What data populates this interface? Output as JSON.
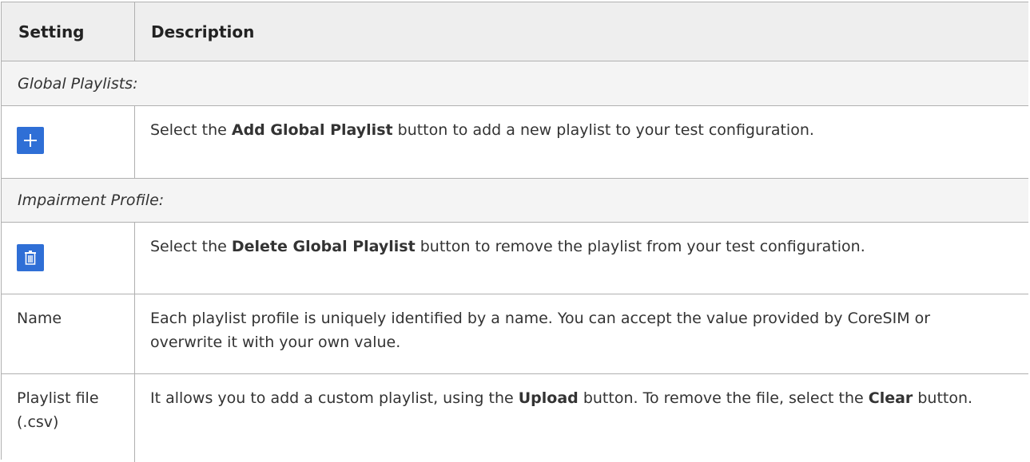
{
  "header": {
    "setting": "Setting",
    "description": "Description"
  },
  "sections": {
    "global_playlists": "Global Playlists:",
    "impairment_profile": "Impairment Profile:"
  },
  "rows": {
    "add": {
      "icon": "plus-icon",
      "pre": "Select the ",
      "bold": "Add Global Playlist",
      "post": " button to add a new playlist to your test configuration."
    },
    "delete": {
      "icon": "trash-icon",
      "pre": "Select the ",
      "bold": "Delete Global Playlist",
      "post": " button to remove the playlist from your test configuration."
    },
    "name": {
      "setting": "Name",
      "description": "Each playlist profile is uniquely identified by a name. You can accept the value provided by CoreSIM or overwrite it with your own value."
    },
    "playlist_file": {
      "setting": "Playlist file (.csv)",
      "pre": "It allows you to add a custom playlist, using the ",
      "bold1": "Upload",
      "mid": " button. To remove the file, select the ",
      "bold2": "Clear",
      "post": " button."
    }
  },
  "colors": {
    "button_blue": "#2f6fd6",
    "header_bg": "#eeeeee",
    "border": "#b0b0b0"
  }
}
